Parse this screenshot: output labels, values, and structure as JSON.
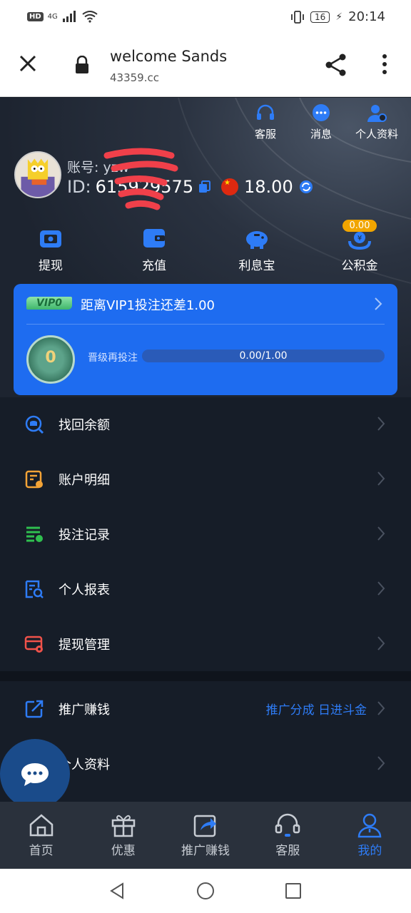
{
  "status_bar": {
    "hd": "HD",
    "network": "4G",
    "battery": "16",
    "time": "20:14"
  },
  "browser": {
    "title": "welcome Sands",
    "url": "43359.cc"
  },
  "top_actions": [
    {
      "label": "客服",
      "icon": "headset-icon"
    },
    {
      "label": "消息",
      "icon": "message-icon"
    },
    {
      "label": "个人资料",
      "icon": "profile-icon"
    }
  ],
  "account": {
    "account_label": "账号:",
    "account_value": "yzw",
    "id_label": "ID:",
    "id_value": "615929575",
    "balance": "18.00"
  },
  "quick_actions": [
    {
      "label": "提现",
      "icon": "withdraw-icon"
    },
    {
      "label": "充值",
      "icon": "wallet-icon"
    },
    {
      "label": "利息宝",
      "icon": "piggy-bank-icon"
    },
    {
      "label": "公积金",
      "icon": "fund-icon",
      "badge": "0.00"
    }
  ],
  "vip": {
    "badge": "VIP0",
    "message": "距离VIP1投注还差1.00",
    "medal_level": "0",
    "upgrade_label": "晋级再投注",
    "progress_text": "0.00/1.00",
    "progress_fraction": 0.0
  },
  "menu": [
    {
      "label": "找回余额",
      "icon": "recover-balance-icon",
      "color": "#2e7cf6"
    },
    {
      "label": "账户明细",
      "icon": "account-detail-icon",
      "color": "#f3a336"
    },
    {
      "label": "投注记录",
      "icon": "bet-record-icon",
      "color": "#2fbf4f"
    },
    {
      "label": "个人报表",
      "icon": "report-icon",
      "color": "#2e7cf6"
    },
    {
      "label": "提现管理",
      "icon": "withdraw-manage-icon",
      "color": "#f0524a"
    }
  ],
  "menu2": [
    {
      "label": "推广赚钱",
      "icon": "promote-icon",
      "extra": "推广分成 日进斗金"
    },
    {
      "label": "个人资料",
      "icon": "profile-doc-icon"
    }
  ],
  "tabs": [
    {
      "label": "首页",
      "icon": "home-icon"
    },
    {
      "label": "优惠",
      "icon": "gift-icon"
    },
    {
      "label": "推广赚钱",
      "icon": "share-icon"
    },
    {
      "label": "客服",
      "icon": "headset-icon"
    },
    {
      "label": "我的",
      "icon": "user-icon",
      "active": true
    }
  ],
  "colors": {
    "accent": "#2e7cf6",
    "vip_card": "#1e6cf0",
    "background": "#161d28",
    "gold": "#f1a500"
  }
}
